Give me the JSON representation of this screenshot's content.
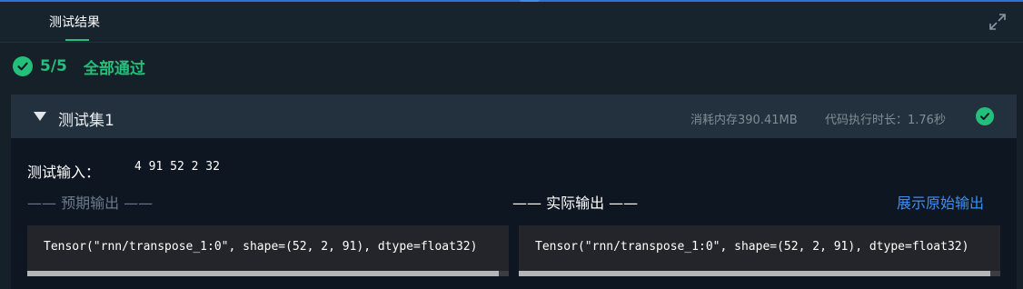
{
  "colors": {
    "accent_green": "#22c07a",
    "link_blue": "#3d8ef0",
    "background": "#152029",
    "panel": "#22313d"
  },
  "header": {
    "tab_label": "测试结果",
    "expand_icon": "expand-icon"
  },
  "summary": {
    "count": "5/5",
    "status": "全部通过",
    "icon": "check-circle-icon"
  },
  "test_case": {
    "title": "测试集1",
    "memory": "消耗内存390.41MB",
    "time": "代码执行时长：1.76秒",
    "input_label": "测试输入：",
    "input_value": "4 91 52 2 32",
    "expected_title": "—— 预期输出 ——",
    "actual_title": "—— 实际输出 ——",
    "raw_output_link": "展示原始输出",
    "expected_output": "Tensor(\"rnn/transpose_1:0\", shape=(52, 2, 91), dtype=float32)",
    "actual_output": "Tensor(\"rnn/transpose_1:0\", shape=(52, 2, 91), dtype=float32)"
  }
}
